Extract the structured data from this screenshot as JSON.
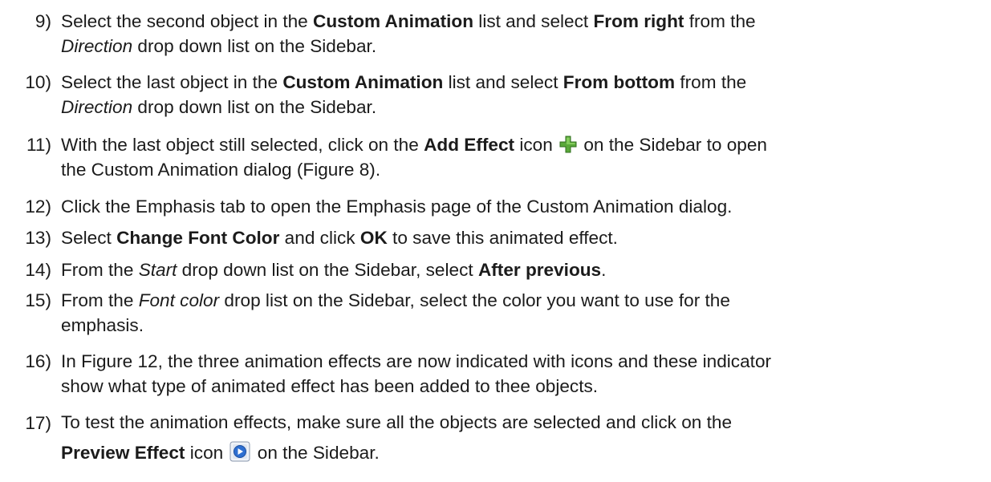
{
  "steps": [
    {
      "num": "9)",
      "parts": [
        {
          "t": "Select the second object in the "
        },
        {
          "t": "Custom Animation",
          "s": "b"
        },
        {
          "t": " list and select "
        },
        {
          "t": "From right",
          "s": "b"
        },
        {
          "t": " from the"
        },
        {
          "br": true
        },
        {
          "t": "Direction",
          "s": "i"
        },
        {
          "t": " drop down list on the Sidebar."
        }
      ]
    },
    {
      "num": "10)",
      "parts": [
        {
          "t": "Select the last object in the "
        },
        {
          "t": "Custom Animation",
          "s": "b"
        },
        {
          "t": " list and select "
        },
        {
          "t": "From bottom",
          "s": "b"
        },
        {
          "t": " from the"
        },
        {
          "br": true
        },
        {
          "t": "Direction",
          "s": "i"
        },
        {
          "t": " drop down list on the Sidebar."
        }
      ]
    },
    {
      "num": "11)",
      "parts": [
        {
          "t": "With the last object still selected, click on the "
        },
        {
          "t": "Add Effect",
          "s": "b"
        },
        {
          "t": " icon "
        },
        {
          "icon": "add-effect-icon"
        },
        {
          "t": " on the Sidebar to open"
        },
        {
          "br": true
        },
        {
          "t": "the Custom Animation dialog (Figure 8)."
        }
      ]
    },
    {
      "num": "12)",
      "parts": [
        {
          "t": "Click the Emphasis tab to open the Emphasis page of the Custom Animation dialog."
        }
      ]
    },
    {
      "num": "13)",
      "parts": [
        {
          "t": "Select "
        },
        {
          "t": "Change Font Color",
          "s": "b"
        },
        {
          "t": " and click "
        },
        {
          "t": "OK",
          "s": "b"
        },
        {
          "t": " to save this animated effect."
        }
      ]
    },
    {
      "num": "14)",
      "parts": [
        {
          "t": "From the "
        },
        {
          "t": "Start",
          "s": "i"
        },
        {
          "t": " drop down list on the Sidebar, select "
        },
        {
          "t": "After previous",
          "s": "b"
        },
        {
          "t": "."
        }
      ]
    },
    {
      "num": "15)",
      "parts": [
        {
          "t": "From the "
        },
        {
          "t": "Font color",
          "s": "i"
        },
        {
          "t": " drop list on the Sidebar, select the color you want to use for the"
        },
        {
          "br": true
        },
        {
          "t": "emphasis."
        }
      ]
    },
    {
      "num": "16)",
      "parts": [
        {
          "t": "In Figure 12, the three animation effects are now indicated with icons and these indicator"
        },
        {
          "br": true
        },
        {
          "t": "show what type of animated effect has been added to thee objects."
        }
      ]
    },
    {
      "num": "17)",
      "parts": [
        {
          "t": "To test the animation effects, make sure all the objects are selected and click on the"
        },
        {
          "br": true
        },
        {
          "t": "Preview Effect",
          "s": "b"
        },
        {
          "t": " icon "
        },
        {
          "icon": "preview-effect-icon"
        },
        {
          "t": " on the Sidebar."
        }
      ]
    }
  ]
}
